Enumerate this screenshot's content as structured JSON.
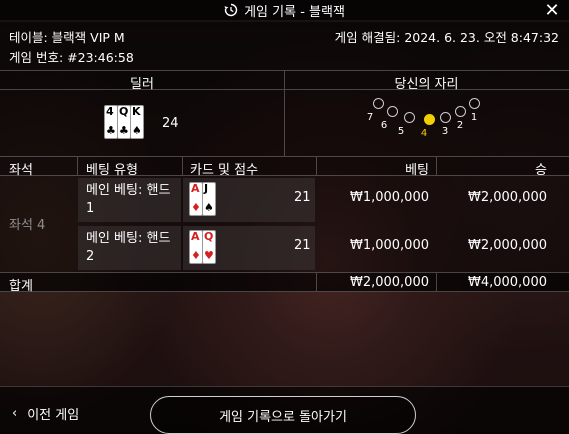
{
  "title": "게임 기록 - 블랙잭",
  "close_label": "✕",
  "info": {
    "table_name": "테이블: 블랙잭 VIP M",
    "game_number": "게임 번호: #23:46:58",
    "resolved": "게임 해결됨: 2024. 6. 23. 오전 8:47:32"
  },
  "dealer": {
    "label": "딜러",
    "cards": [
      {
        "rank": "4",
        "suit": "♣",
        "red": false
      },
      {
        "rank": "Q",
        "suit": "♣",
        "red": false
      },
      {
        "rank": "K",
        "suit": "♠",
        "red": false
      }
    ],
    "score": "24"
  },
  "seat_section": {
    "label": "당신의 자리",
    "seats": [
      "7",
      "6",
      "5",
      "4",
      "3",
      "2",
      "1"
    ],
    "active_seat": "4"
  },
  "table": {
    "headers": {
      "seat": "좌석",
      "bet_type": "베팅 유형",
      "cards": "카드 및 점수",
      "bet": "베팅",
      "win": "승"
    },
    "seat_label": "좌석 4",
    "rows": [
      {
        "bet_type": "메인 베팅: 핸드 1",
        "cards": [
          {
            "rank": "A",
            "suit": "♦",
            "red": true
          },
          {
            "rank": "J",
            "suit": "♠",
            "red": false
          }
        ],
        "score": "21",
        "bet": "₩1,000,000",
        "win": "₩2,000,000"
      },
      {
        "bet_type": "메인 베팅: 핸드 2",
        "cards": [
          {
            "rank": "A",
            "suit": "♦",
            "red": true
          },
          {
            "rank": "Q",
            "suit": "♥",
            "red": true
          }
        ],
        "score": "21",
        "bet": "₩1,000,000",
        "win": "₩2,000,000"
      }
    ],
    "total": {
      "label": "합계",
      "bet": "₩2,000,000",
      "win": "₩4,000,000"
    }
  },
  "bottom": {
    "prev_label": "이전 게임",
    "back_label": "게임 기록으로 돌아가기"
  }
}
